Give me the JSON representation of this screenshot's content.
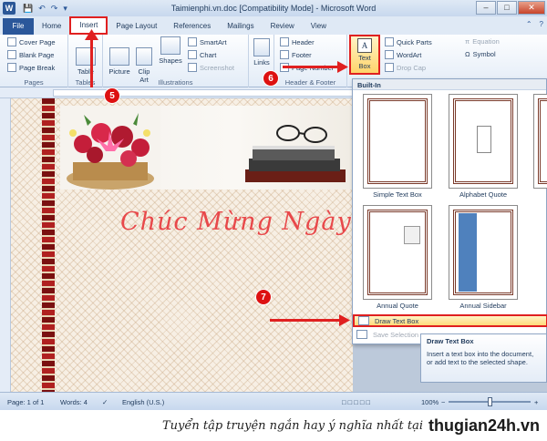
{
  "window": {
    "title": "Taimienphi.vn.doc [Compatibility Mode] - Microsoft Word",
    "app_icon": "W",
    "qat": [
      "save-icon",
      "undo-icon",
      "redo-icon",
      "customize-icon"
    ],
    "buttons": [
      "–",
      "□",
      "✕"
    ]
  },
  "tabs": [
    "File",
    "Home",
    "Insert",
    "Page Layout",
    "References",
    "Mailings",
    "Review",
    "View"
  ],
  "tab_right": [
    "help-icon"
  ],
  "ribbon": {
    "pages": {
      "items": [
        "Cover Page",
        "Blank Page",
        "Page Break"
      ],
      "label": "Pages"
    },
    "tables": {
      "item": "Table",
      "label": "Tables"
    },
    "illustrations": {
      "picture": "Picture",
      "clip_art": "Clip\nArt",
      "shapes": "Shapes",
      "smartart": "SmartArt",
      "chart": "Chart",
      "screenshot": "Screenshot",
      "label": "Illustrations"
    },
    "links": {
      "item": "Links"
    },
    "header_footer": {
      "header": "Header",
      "footer": "Footer",
      "page_number": "Page Number",
      "label": "Header & Footer"
    },
    "text": {
      "text_box": "Text",
      "text_box2": "Box",
      "quick_parts": "Quick Parts",
      "wordart": "WordArt",
      "drop_cap": "Drop Cap"
    },
    "symbols": {
      "equation": "Equation",
      "symbol": "Symbol"
    }
  },
  "document": {
    "script_text": "Chúc Mừng Ngày"
  },
  "dropdown": {
    "heading": "Built-In",
    "thumbs": [
      {
        "label": "Simple Text Box"
      },
      {
        "label": "Alphabet Quote"
      },
      {
        "label": "Annual Quote"
      },
      {
        "label": "Annual Sidebar"
      }
    ],
    "draw": "Draw Text Box",
    "save": "Save Selection"
  },
  "tooltip": {
    "title": "Draw Text Box",
    "body": "Insert a text box into the document, or add text to the selected shape."
  },
  "markers": [
    "5",
    "6",
    "7"
  ],
  "status": {
    "page": "Page: 1 of 1",
    "words": "Words: 4",
    "language": "English (U.S.)",
    "zoom": "100%",
    "zoom_fraction": 0.5
  },
  "caption": {
    "text": "Tuyển tập truyện ngắn hay ý nghĩa nhất tại",
    "site": "thugian24h.vn"
  }
}
